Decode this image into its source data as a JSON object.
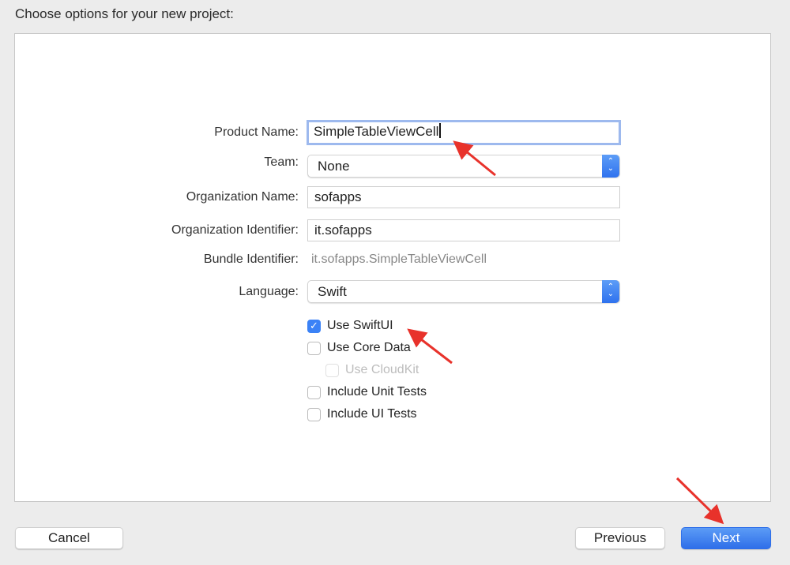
{
  "header": {
    "title": "Choose options for your new project:"
  },
  "form": {
    "product_name": {
      "label": "Product Name:",
      "value": "SimpleTableViewCell"
    },
    "team": {
      "label": "Team:",
      "value": "None"
    },
    "organization_name": {
      "label": "Organization Name:",
      "value": "sofapps"
    },
    "organization_identifier": {
      "label": "Organization Identifier:",
      "value": "it.sofapps"
    },
    "bundle_identifier": {
      "label": "Bundle Identifier:",
      "value": "it.sofapps.SimpleTableViewCell"
    },
    "language": {
      "label": "Language:",
      "value": "Swift"
    },
    "options": [
      {
        "label": "Use SwiftUI",
        "checked": true,
        "enabled": true
      },
      {
        "label": "Use Core Data",
        "checked": false,
        "enabled": true
      },
      {
        "label": "Use CloudKit",
        "checked": false,
        "enabled": false
      },
      {
        "label": "Include Unit Tests",
        "checked": false,
        "enabled": true
      },
      {
        "label": "Include UI Tests",
        "checked": false,
        "enabled": true
      }
    ]
  },
  "footer": {
    "cancel_label": "Cancel",
    "previous_label": "Previous",
    "next_label": "Next"
  },
  "colors": {
    "accent": "#3b82f6",
    "annotation_arrow": "#e8322b"
  },
  "icons": {
    "checkmark": "✓",
    "stepper_up": "⌃",
    "stepper_down": "⌄"
  }
}
